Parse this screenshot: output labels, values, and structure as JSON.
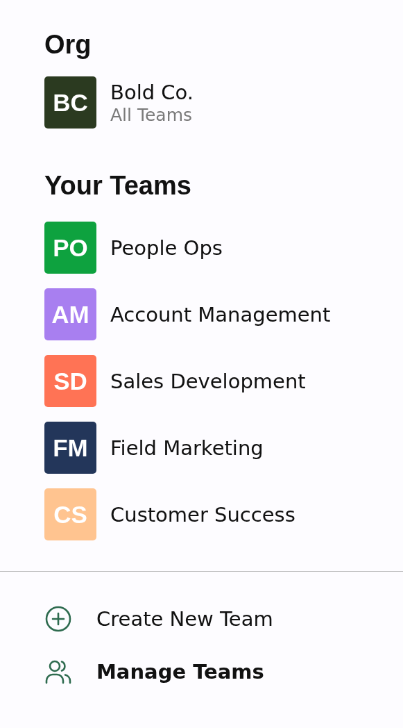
{
  "org": {
    "heading": "Org",
    "initials": "BC",
    "color": "#2b3a20",
    "name": "Bold Co.",
    "subtitle": "All Teams"
  },
  "teams": {
    "heading": "Your Teams",
    "items": [
      {
        "initials": "PO",
        "name": "People Ops",
        "color": "#0ea23f"
      },
      {
        "initials": "AM",
        "name": "Account Management",
        "color": "#a87ff0"
      },
      {
        "initials": "SD",
        "name": "Sales Development",
        "color": "#ff7355"
      },
      {
        "initials": "FM",
        "name": "Field Marketing",
        "color": "#23365a"
      },
      {
        "initials": "CS",
        "name": "Customer Success",
        "color": "#ffc490"
      }
    ]
  },
  "actions": [
    {
      "kind": "create",
      "label": "Create New Team",
      "selected": false
    },
    {
      "kind": "manage",
      "label": "Manage Teams",
      "selected": true
    }
  ]
}
